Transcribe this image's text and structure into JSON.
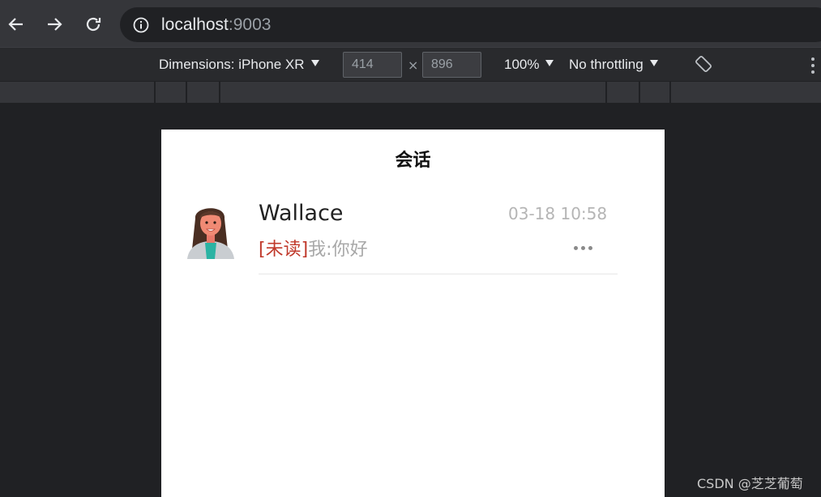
{
  "browser": {
    "url_host": "localhost",
    "url_port": ":9003"
  },
  "devtools": {
    "dimensions_label": "Dimensions: iPhone XR",
    "width": "414",
    "height": "896",
    "times": "×",
    "zoom": "100%",
    "throttling": "No throttling"
  },
  "page": {
    "title": "会话",
    "conversations": [
      {
        "name": "Wallace",
        "time": "03-18 10:58",
        "unread_tag": "[未读]",
        "message": "我:你好"
      }
    ]
  },
  "watermark": "CSDN @芝芝葡萄",
  "colors": {
    "unread": "#c0392b",
    "muted": "#a8a8a8"
  }
}
